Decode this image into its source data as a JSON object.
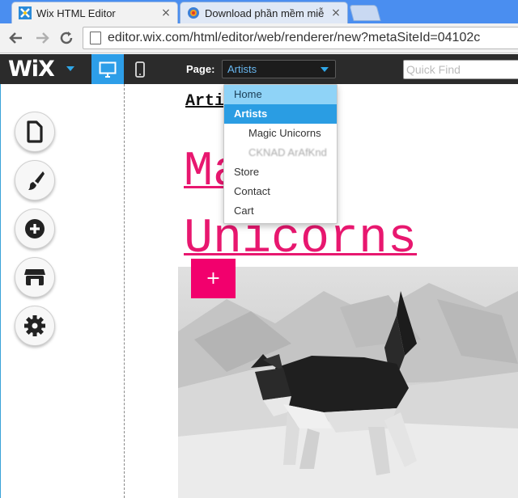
{
  "browser": {
    "tabs": [
      {
        "title": "Wix HTML Editor",
        "active": true
      },
      {
        "title": "Download phần mềm miễ",
        "active": false
      }
    ],
    "close_glyph": "×",
    "url": "editor.wix.com/html/editor/web/renderer/new?metaSiteId=04102c"
  },
  "wix_bar": {
    "logo": "WiX",
    "page_label": "Page:",
    "page_selected": "Artists",
    "quick_find_placeholder": "Quick Find"
  },
  "dropdown": {
    "items": [
      {
        "label": "Home",
        "state": "hover",
        "level": 0
      },
      {
        "label": "Artists",
        "state": "selected",
        "level": 0
      },
      {
        "label": "Magic Unicorns",
        "state": "normal",
        "level": 1
      },
      {
        "label": "CKNAD ArAfKnd",
        "state": "blurred",
        "level": 1
      },
      {
        "label": "Store",
        "state": "normal",
        "level": 0
      },
      {
        "label": "Contact",
        "state": "normal",
        "level": 0
      },
      {
        "label": "Cart",
        "state": "normal",
        "level": 0
      }
    ]
  },
  "canvas": {
    "breadcrumb": "Artists",
    "heading": "Magic Unicorns",
    "add_button": "+"
  },
  "left_tools": [
    {
      "name": "pages-icon"
    },
    {
      "name": "design-brush-icon"
    },
    {
      "name": "add-plus-icon"
    },
    {
      "name": "app-market-icon"
    },
    {
      "name": "settings-gear-icon"
    }
  ],
  "colors": {
    "accent_blue": "#2d9ee8",
    "wix_bar": "#2b2b2b",
    "heading_pink": "#e8176f",
    "add_button": "#f2006d"
  }
}
